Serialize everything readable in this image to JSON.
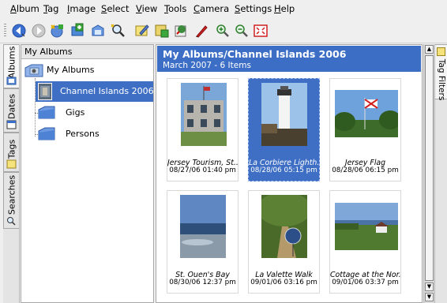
{
  "menubar": {
    "items": [
      "Album",
      "Tag",
      "Image",
      "Select",
      "View",
      "Tools",
      "Camera",
      "Settings",
      "Help"
    ]
  },
  "toolbar": {
    "buttons": [
      "back-icon",
      "forward-icon",
      "new-album-icon",
      "add-images-icon",
      "import-icon",
      "search-icon",
      "edit-tag-icon",
      "batch-icon",
      "properties-icon",
      "edit-image-icon",
      "zoom-in-icon",
      "zoom-out-icon",
      "fullscreen-icon"
    ]
  },
  "sidebar": {
    "tabs": [
      "Albums",
      "Dates",
      "Tags",
      "Searches"
    ],
    "active_tab": "Albums"
  },
  "album_tree": {
    "header": "My Albums",
    "root": "My Albums",
    "items": [
      "Channel Islands 2006",
      "Gigs",
      "Persons"
    ],
    "selected": "Channel Islands 2006"
  },
  "main": {
    "title": "My Albums/Channel Islands 2006",
    "subtitle": "March 2007 - 6 Items",
    "thumbnails": [
      {
        "caption": "Jersey Tourism, St...",
        "date": "08/27/06 01:40 pm",
        "selected": false
      },
      {
        "caption": "La Corbiere Lighth...",
        "date": "08/28/06 05:15 pm",
        "selected": true
      },
      {
        "caption": "Jersey Flag",
        "date": "08/28/06 06:15 pm",
        "selected": false
      },
      {
        "caption": "St. Ouen's Bay",
        "date": "08/30/06 12:37 pm",
        "selected": false
      },
      {
        "caption": "La Valette Walk",
        "date": "09/01/06 03:16 pm",
        "selected": false
      },
      {
        "caption": "Cottage at the Nor...",
        "date": "09/01/06 03:37 pm",
        "selected": false
      }
    ]
  },
  "right_sidebar": {
    "tabs": [
      "Tag Filters"
    ]
  },
  "colors": {
    "selection": "#3f6fc4",
    "banner": "#3c6ec6"
  }
}
